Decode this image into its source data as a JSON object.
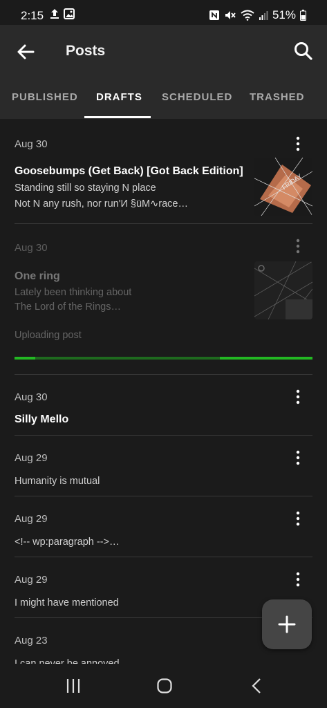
{
  "status_bar": {
    "time": "2:15",
    "battery": "51%",
    "left_icons": [
      "upload-icon",
      "image-icon"
    ],
    "right_icons": [
      "nfc-icon",
      "mute-icon",
      "wifi-icon",
      "signal-icon",
      "battery-icon"
    ]
  },
  "app_bar": {
    "title": "Posts",
    "back_icon": "arrow-back-icon",
    "search_icon": "search-icon"
  },
  "tabs": [
    {
      "label": "PUBLISHED",
      "active": false
    },
    {
      "label": "DRAFTS",
      "active": true
    },
    {
      "label": "SCHEDULED",
      "active": false
    },
    {
      "label": "TRASHED",
      "active": false
    }
  ],
  "posts": [
    {
      "date": "Aug 30",
      "title": "Goosebumps (Get Back) [Got Back Edition]",
      "excerpt_line1": "Standing still so staying N place",
      "excerpt_line2": "Not N any rush, nor run'И §üM∿race…",
      "has_thumbnail": true,
      "thumbnail_text": "FRIDAY"
    },
    {
      "date": "Aug 30",
      "title": "One ring",
      "excerpt_line1": "Lately been thinking about",
      "excerpt_line2": "The Lord of the Rings…",
      "has_thumbnail": true,
      "status": "Uploading post",
      "progress_segments": [
        0.07,
        0.69
      ]
    },
    {
      "date": "Aug 30",
      "title": "Silly Mello"
    },
    {
      "date": "Aug 29",
      "excerpt_line1": "Humanity is mutual"
    },
    {
      "date": "Aug 29",
      "excerpt_line1": "<!-- wp:paragraph -->…"
    },
    {
      "date": "Aug 29",
      "excerpt_line1": "I might have mentioned"
    },
    {
      "date": "Aug 23",
      "excerpt_line1": "I can never be annoyed"
    }
  ],
  "fab": {
    "icon": "plus-icon"
  },
  "nav_bar": {
    "icons": [
      "recents-icon",
      "home-icon",
      "back-icon"
    ]
  },
  "colors": {
    "background": "#1b1b1b",
    "app_bar": "#2a2a2a",
    "progress": "#23b823",
    "fab": "#454545"
  }
}
